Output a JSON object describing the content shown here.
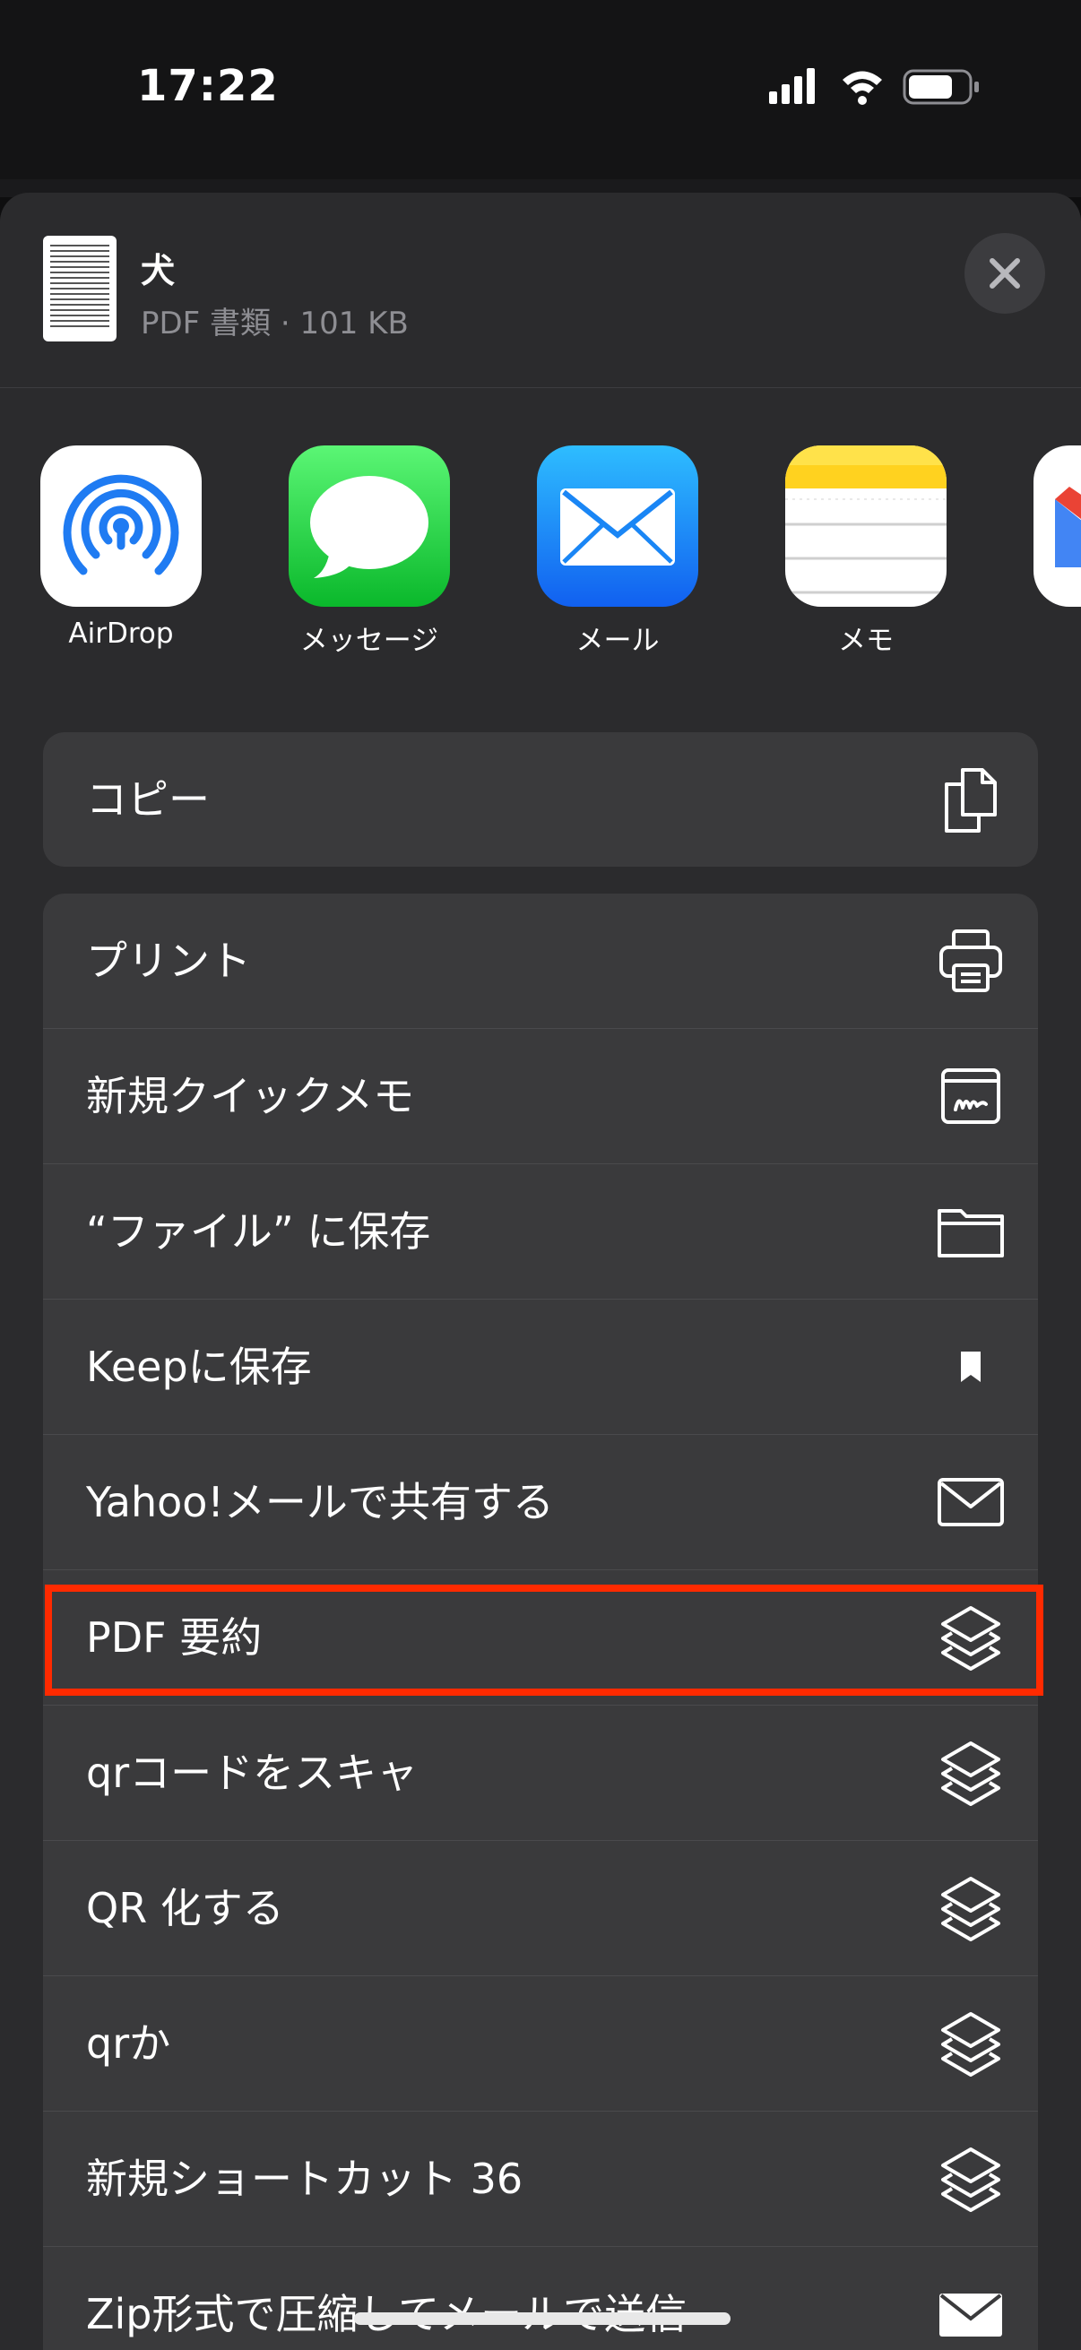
{
  "status": {
    "time": "17:22"
  },
  "sheet": {
    "title": "犬",
    "subtitle": "PDF 書類 · 101 KB"
  },
  "apps": [
    {
      "label": "AirDrop",
      "icon": "airdrop-icon"
    },
    {
      "label": "メッセージ",
      "icon": "messages-icon"
    },
    {
      "label": "メール",
      "icon": "mail-icon"
    },
    {
      "label": "メモ",
      "icon": "notes-icon"
    },
    {
      "label": "",
      "icon": "gmail-icon"
    }
  ],
  "copy_group": [
    {
      "label": "コピー",
      "icon": "copy-icon"
    }
  ],
  "actions": [
    {
      "label": "プリント",
      "icon": "printer-icon"
    },
    {
      "label": "新規クイックメモ",
      "icon": "quick-note-icon"
    },
    {
      "label": "“ファイル” に保存",
      "icon": "folder-icon"
    },
    {
      "label": "Keepに保存",
      "icon": "bookmark-icon"
    },
    {
      "label": "Yahoo!メールで共有する",
      "icon": "envelope-icon"
    },
    {
      "label": "PDF 要約",
      "icon": "shortcuts-icon"
    },
    {
      "label": "qrコードをスキャ",
      "icon": "shortcuts-icon"
    },
    {
      "label": "QR 化する",
      "icon": "shortcuts-icon"
    },
    {
      "label": "qrか",
      "icon": "shortcuts-icon"
    },
    {
      "label": "新規ショートカット 36",
      "icon": "shortcuts-icon"
    },
    {
      "label": "Zip形式で圧縮してメールで送信",
      "icon": "envelope-filled-icon"
    }
  ],
  "colors": {
    "highlight": "#ff2a00",
    "sheet_bg": "#2b2b2d",
    "row_bg": "#3a3a3c"
  }
}
